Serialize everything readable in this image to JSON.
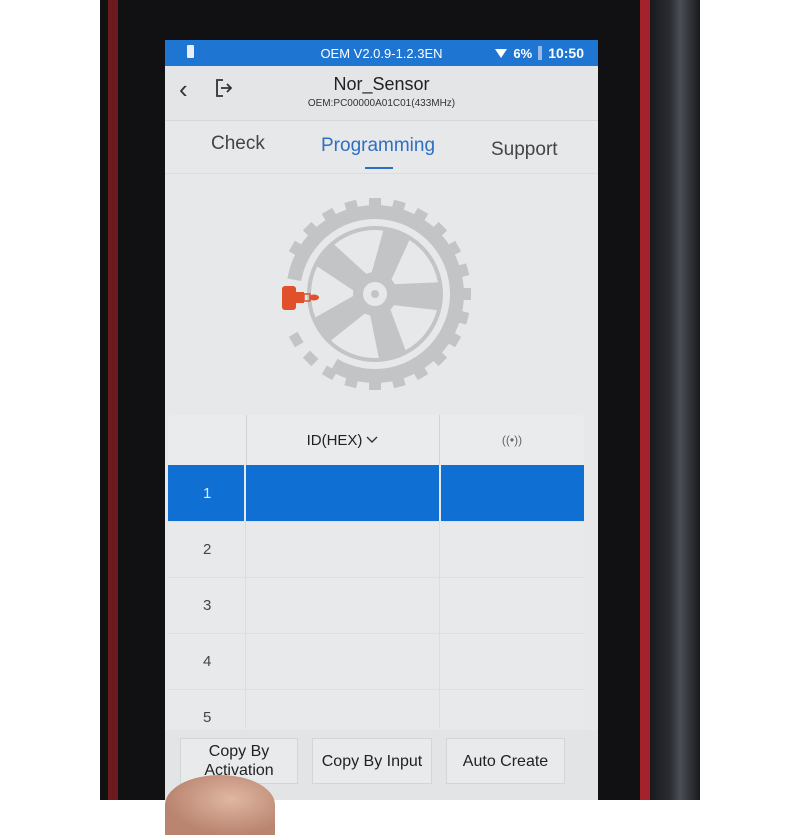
{
  "statusbar": {
    "version": "OEM V2.0.9-1.2.3EN",
    "battery_percent": "6%",
    "time": "10:50",
    "icons": [
      "battery-alert-icon",
      "wifi-icon",
      "battery-icon"
    ]
  },
  "header": {
    "title": "Nor_Sensor",
    "subtitle": "OEM:PC00000A01C01(433MHz)",
    "back_icon": "chevron-left-icon",
    "exit_icon": "exit-icon"
  },
  "tabs": [
    {
      "label": "Check",
      "active": false
    },
    {
      "label": "Programming",
      "active": true
    },
    {
      "label": "Support",
      "active": false
    }
  ],
  "illustration": {
    "description": "tire-with-sensor",
    "tire_color": "#c3c4c6",
    "sensor_color": "#e0502a"
  },
  "table": {
    "headers": {
      "index": "",
      "id": "ID(HEX)",
      "id_sort_icon": "chevron-down-icon",
      "signal_icon": "signal-waves-icon",
      "signal_glyph": "((•))"
    },
    "rows": [
      {
        "index": "1",
        "id": "",
        "signal": "",
        "selected": true
      },
      {
        "index": "2",
        "id": "",
        "signal": "",
        "selected": false
      },
      {
        "index": "3",
        "id": "",
        "signal": "",
        "selected": false
      },
      {
        "index": "4",
        "id": "",
        "signal": "",
        "selected": false
      },
      {
        "index": "5",
        "id": "",
        "signal": "",
        "selected": false
      }
    ]
  },
  "buttons": {
    "copy_by_activation": "Copy By Activation",
    "copy_by_activation_line1": "Copy By",
    "copy_by_activation_line2": "Activation",
    "copy_by_input": "Copy By Input",
    "auto_create": "Auto Create"
  },
  "colors": {
    "accent": "#1f75d2",
    "selected_row": "#0f6fd3",
    "active_tab": "#2d6fc4",
    "sensor": "#e0502a"
  }
}
